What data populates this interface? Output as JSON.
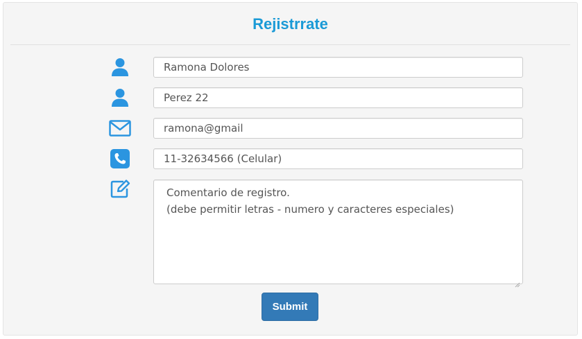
{
  "form": {
    "title": "Rejistrrate",
    "fields": [
      {
        "icon": "user-icon",
        "value": "Ramona Dolores"
      },
      {
        "icon": "user-icon",
        "value": "Perez 22"
      },
      {
        "icon": "envelope-icon",
        "value": "ramona@gmail"
      },
      {
        "icon": "phone-icon",
        "value": "11-32634566 (Celular)"
      }
    ],
    "comment": {
      "icon": "edit-icon",
      "line1": "Comentario de registro.",
      "line2": "(debe permitir letras - numero y caracteres especiales)"
    },
    "submit_label": "Submit"
  },
  "colors": {
    "accent": "#1a9ad6",
    "icon": "#2b95e0",
    "button": "#337ab7"
  }
}
